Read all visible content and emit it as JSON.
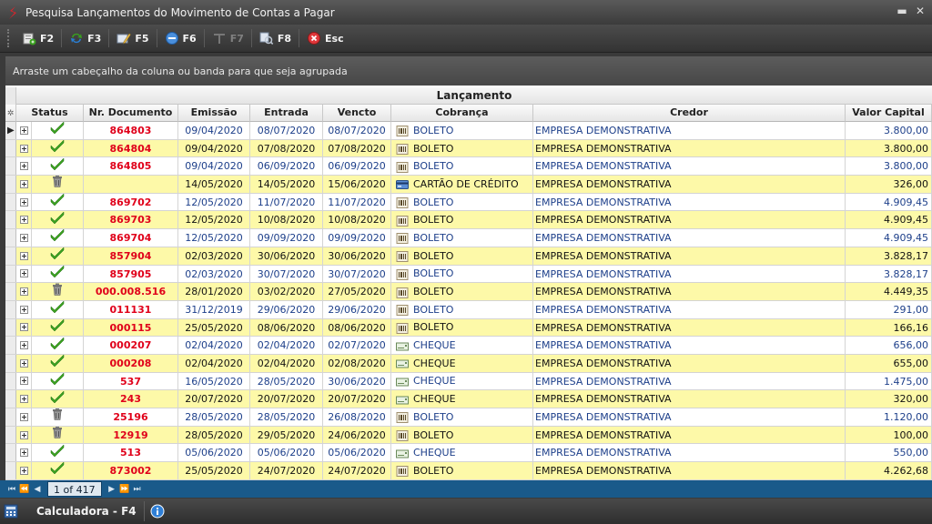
{
  "window": {
    "title": "Pesquisa Lançamentos do Movimento de Contas a Pagar"
  },
  "toolbar": {
    "buttons": [
      {
        "label": "F2",
        "icon": "new-record-icon",
        "enabled": true
      },
      {
        "label": "F3",
        "icon": "refresh-icon",
        "enabled": true
      },
      {
        "label": "F5",
        "icon": "edit-icon",
        "enabled": true
      },
      {
        "label": "F6",
        "icon": "cancel-record-icon",
        "enabled": true
      },
      {
        "label": "F7",
        "icon": "stamp-icon",
        "enabled": false
      },
      {
        "label": "F8",
        "icon": "search-records-icon",
        "enabled": true
      },
      {
        "label": "Esc",
        "icon": "close-circle-icon",
        "enabled": true
      }
    ]
  },
  "group_panel": {
    "hint": "Arraste um cabeçalho da coluna ou banda para que seja agrupada"
  },
  "grid": {
    "band_title": "Lançamento",
    "columns": {
      "status": "Status",
      "documento": "Nr. Documento",
      "emissao": "Emissão",
      "entrada": "Entrada",
      "vencto": "Vencto",
      "cobranca": "Cobrança",
      "credor": "Credor",
      "valor": "Valor Capital"
    },
    "rows": [
      {
        "status": "paid",
        "doc": "864803",
        "emissao": "09/04/2020",
        "entrada": "08/07/2020",
        "vencto": "08/07/2020",
        "cobranca": "BOLETO",
        "cob_icon": "boleto",
        "credor": "EMPRESA DEMONSTRATIVA",
        "valor": "3.800,00",
        "style": "white",
        "current": true
      },
      {
        "status": "paid",
        "doc": "864804",
        "emissao": "09/04/2020",
        "entrada": "07/08/2020",
        "vencto": "07/08/2020",
        "cobranca": "BOLETO",
        "cob_icon": "boleto",
        "credor": "EMPRESA DEMONSTRATIVA",
        "valor": "3.800,00",
        "style": "yellow"
      },
      {
        "status": "paid",
        "doc": "864805",
        "emissao": "09/04/2020",
        "entrada": "06/09/2020",
        "vencto": "06/09/2020",
        "cobranca": "BOLETO",
        "cob_icon": "boleto",
        "credor": "EMPRESA DEMONSTRATIVA",
        "valor": "3.800,00",
        "style": "white"
      },
      {
        "status": "deleted",
        "doc": "",
        "emissao": "14/05/2020",
        "entrada": "14/05/2020",
        "vencto": "15/06/2020",
        "cobranca": "CARTÃO DE CRÉDITO",
        "cob_icon": "card",
        "credor": "EMPRESA DEMONSTRATIVA",
        "valor": "326,00",
        "style": "yellow"
      },
      {
        "status": "paid",
        "doc": "869702",
        "emissao": "12/05/2020",
        "entrada": "11/07/2020",
        "vencto": "11/07/2020",
        "cobranca": "BOLETO",
        "cob_icon": "boleto",
        "credor": "EMPRESA DEMONSTRATIVA",
        "valor": "4.909,45",
        "style": "white"
      },
      {
        "status": "paid",
        "doc": "869703",
        "emissao": "12/05/2020",
        "entrada": "10/08/2020",
        "vencto": "10/08/2020",
        "cobranca": "BOLETO",
        "cob_icon": "boleto",
        "credor": "EMPRESA DEMONSTRATIVA",
        "valor": "4.909,45",
        "style": "yellow"
      },
      {
        "status": "paid",
        "doc": "869704",
        "emissao": "12/05/2020",
        "entrada": "09/09/2020",
        "vencto": "09/09/2020",
        "cobranca": "BOLETO",
        "cob_icon": "boleto",
        "credor": "EMPRESA DEMONSTRATIVA",
        "valor": "4.909,45",
        "style": "white"
      },
      {
        "status": "paid",
        "doc": "857904",
        "emissao": "02/03/2020",
        "entrada": "30/06/2020",
        "vencto": "30/06/2020",
        "cobranca": "BOLETO",
        "cob_icon": "boleto",
        "credor": "EMPRESA DEMONSTRATIVA",
        "valor": "3.828,17",
        "style": "yellow"
      },
      {
        "status": "paid",
        "doc": "857905",
        "emissao": "02/03/2020",
        "entrada": "30/07/2020",
        "vencto": "30/07/2020",
        "cobranca": "BOLETO",
        "cob_icon": "boleto",
        "credor": "EMPRESA DEMONSTRATIVA",
        "valor": "3.828,17",
        "style": "white"
      },
      {
        "status": "deleted",
        "doc": "000.008.516",
        "emissao": "28/01/2020",
        "entrada": "03/02/2020",
        "vencto": "27/05/2020",
        "cobranca": "BOLETO",
        "cob_icon": "boleto",
        "credor": "EMPRESA DEMONSTRATIVA",
        "valor": "4.449,35",
        "style": "yellow"
      },
      {
        "status": "paid",
        "doc": "011131",
        "emissao": "31/12/2019",
        "entrada": "29/06/2020",
        "vencto": "29/06/2020",
        "cobranca": "BOLETO",
        "cob_icon": "boleto",
        "credor": "EMPRESA DEMONSTRATIVA",
        "valor": "291,00",
        "style": "white"
      },
      {
        "status": "paid",
        "doc": "000115",
        "emissao": "25/05/2020",
        "entrada": "08/06/2020",
        "vencto": "08/06/2020",
        "cobranca": "BOLETO",
        "cob_icon": "boleto",
        "credor": "EMPRESA DEMONSTRATIVA",
        "valor": "166,16",
        "style": "yellow"
      },
      {
        "status": "paid",
        "doc": "000207",
        "emissao": "02/04/2020",
        "entrada": "02/04/2020",
        "vencto": "02/07/2020",
        "cobranca": "CHEQUE",
        "cob_icon": "cheque",
        "credor": "EMPRESA DEMONSTRATIVA",
        "valor": "656,00",
        "style": "white"
      },
      {
        "status": "paid",
        "doc": "000208",
        "emissao": "02/04/2020",
        "entrada": "02/04/2020",
        "vencto": "02/08/2020",
        "cobranca": "CHEQUE",
        "cob_icon": "cheque",
        "credor": "EMPRESA DEMONSTRATIVA",
        "valor": "655,00",
        "style": "yellow"
      },
      {
        "status": "paid",
        "doc": "537",
        "emissao": "16/05/2020",
        "entrada": "28/05/2020",
        "vencto": "30/06/2020",
        "cobranca": "CHEQUE",
        "cob_icon": "cheque",
        "credor": "EMPRESA DEMONSTRATIVA",
        "valor": "1.475,00",
        "style": "white"
      },
      {
        "status": "paid",
        "doc": "243",
        "emissao": "20/07/2020",
        "entrada": "20/07/2020",
        "vencto": "20/07/2020",
        "cobranca": "CHEQUE",
        "cob_icon": "cheque",
        "credor": "EMPRESA DEMONSTRATIVA",
        "valor": "320,00",
        "style": "yellow"
      },
      {
        "status": "deleted",
        "doc": "25196",
        "emissao": "28/05/2020",
        "entrada": "28/05/2020",
        "vencto": "26/08/2020",
        "cobranca": "BOLETO",
        "cob_icon": "boleto",
        "credor": "EMPRESA DEMONSTRATIVA",
        "valor": "1.120,00",
        "style": "white"
      },
      {
        "status": "deleted",
        "doc": "12919",
        "emissao": "28/05/2020",
        "entrada": "29/05/2020",
        "vencto": "24/06/2020",
        "cobranca": "BOLETO",
        "cob_icon": "boleto",
        "credor": "EMPRESA DEMONSTRATIVA",
        "valor": "100,00",
        "style": "yellow"
      },
      {
        "status": "paid",
        "doc": "513",
        "emissao": "05/06/2020",
        "entrada": "05/06/2020",
        "vencto": "05/06/2020",
        "cobranca": "CHEQUE",
        "cob_icon": "cheque",
        "credor": "EMPRESA DEMONSTRATIVA",
        "valor": "550,00",
        "style": "white"
      },
      {
        "status": "paid",
        "doc": "873002",
        "emissao": "25/05/2020",
        "entrada": "24/07/2020",
        "vencto": "24/07/2020",
        "cobranca": "BOLETO",
        "cob_icon": "boleto",
        "credor": "EMPRESA DEMONSTRATIVA",
        "valor": "4.262,68",
        "style": "yellow"
      }
    ]
  },
  "navigator": {
    "record_info": "1 of 417"
  },
  "statusbar": {
    "calculator_label": "Calculadora - F4"
  },
  "colors": {
    "yellow_row": "#fdf9a8",
    "doc_red": "#e0001a",
    "value_blue": "#1d3f8a",
    "navbar_blue": "#1a5a8a",
    "paid_green": "#3aa11f"
  }
}
